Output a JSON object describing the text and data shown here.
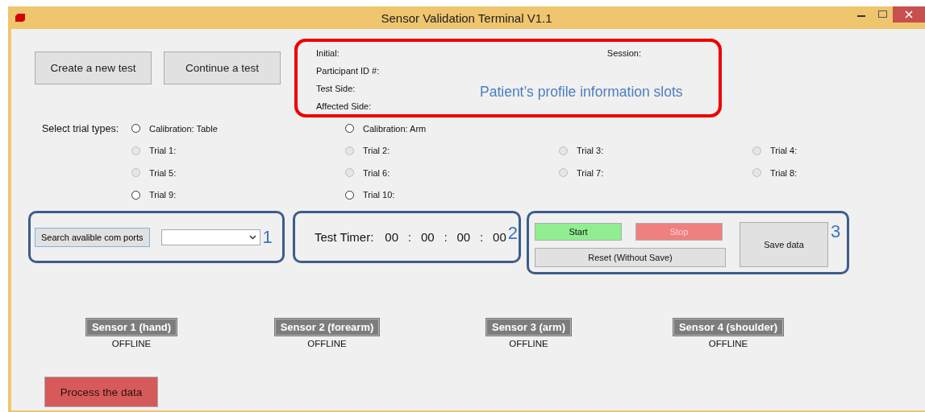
{
  "window": {
    "title": "Sensor Validation Terminal V1.1"
  },
  "top_buttons": [
    "Create a new test",
    "Continue a test"
  ],
  "profile": {
    "fields": [
      "Initial:",
      "Participant ID #:",
      "Test Side:",
      "Affected Side:"
    ],
    "session_label": "Session:",
    "annotation": "Patient’s profile information slots"
  },
  "trial_types": {
    "label": "Select trial types:",
    "options": [
      {
        "label": "Calibration: Table",
        "selected": false,
        "disabled": false
      },
      {
        "label": "Calibration: Arm",
        "selected": false,
        "disabled": false
      },
      {
        "label": "Trial 1:",
        "selected": false,
        "disabled": true
      },
      {
        "label": "Trial 2:",
        "selected": false,
        "disabled": true
      },
      {
        "label": "Trial 3:",
        "selected": false,
        "disabled": true
      },
      {
        "label": "Trial 4:",
        "selected": false,
        "disabled": true
      },
      {
        "label": "Trial 5:",
        "selected": false,
        "disabled": true
      },
      {
        "label": "Trial 6:",
        "selected": false,
        "disabled": true
      },
      {
        "label": "Trial 7:",
        "selected": false,
        "disabled": true
      },
      {
        "label": "Trial 8:",
        "selected": false,
        "disabled": true
      },
      {
        "label": "Trial 9:",
        "selected": false,
        "disabled": false
      },
      {
        "label": "Trial 10:",
        "selected": false,
        "disabled": false
      }
    ]
  },
  "com_ports": {
    "search_button": "Search avalible com ports",
    "annotation": "1"
  },
  "timer": {
    "label": "Test Timer:",
    "parts": [
      "00",
      "00",
      "00",
      "00"
    ],
    "separator": ":",
    "annotation": "2"
  },
  "controls": {
    "start": {
      "label": "Start",
      "disabled": false
    },
    "stop": {
      "label": "Stop",
      "disabled": true
    },
    "reset": "Reset (Without Save)",
    "save": "Save data",
    "annotation": "3"
  },
  "sensors": [
    {
      "name": "Sensor 1 (hand)",
      "status": "OFFLINE"
    },
    {
      "name": "Sensor 2 (forearm)",
      "status": "OFFLINE"
    },
    {
      "name": "Sensor 3 (arm)",
      "status": "OFFLINE"
    },
    {
      "name": "Sensor 4 (shoulder)",
      "status": "OFFLINE"
    }
  ],
  "process_button": "Process the data"
}
